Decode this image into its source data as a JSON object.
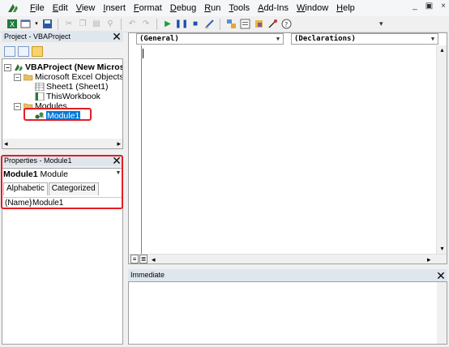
{
  "menu": {
    "items": [
      "File",
      "Edit",
      "View",
      "Insert",
      "Format",
      "Debug",
      "Run",
      "Tools",
      "Add-Ins",
      "Window",
      "Help"
    ]
  },
  "window_controls": [
    "_",
    "▣",
    "×"
  ],
  "toolbar": {
    "buttons": [
      "excel-icon",
      "insert-userform-icon",
      "save-icon",
      "cut-icon",
      "copy-icon",
      "paste-icon",
      "find-icon",
      "undo-icon",
      "redo-icon",
      "run-icon",
      "break-icon",
      "reset-icon",
      "design-mode-icon",
      "project-explorer-icon",
      "properties-window-icon",
      "object-browser-icon",
      "toolbox-icon",
      "help-icon"
    ]
  },
  "project_pane": {
    "title": "Project - VBAProject",
    "tree": {
      "root": "VBAProject (New Microsoft",
      "folder_objects": "Microsoft Excel Objects",
      "sheet1": "Sheet1 (Sheet1)",
      "workbook": "ThisWorkbook",
      "folder_modules": "Modules",
      "module1": "Module1"
    }
  },
  "properties_pane": {
    "title": "Properties - Module1",
    "object_name": "Module1",
    "object_type": "Module",
    "tabs": [
      "Alphabetic",
      "Categorized"
    ],
    "rows": [
      {
        "name": "(Name)",
        "value": "Module1"
      }
    ]
  },
  "code_window": {
    "object_combo": "(General)",
    "procedure_combo": "(Declarations)"
  },
  "immediate": {
    "title": "Immediate"
  },
  "colors": {
    "highlight": "#e51c23",
    "selection": "#0078d7",
    "pane_title": "#dfe6ee"
  }
}
